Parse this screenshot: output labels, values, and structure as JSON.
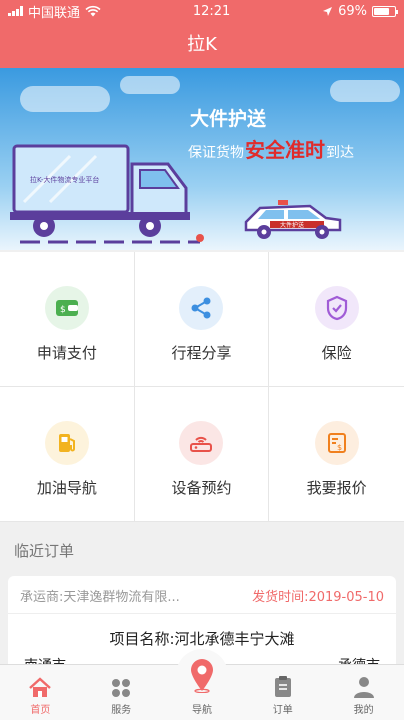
{
  "status_bar": {
    "carrier": "中国联通",
    "time": "12:21",
    "battery": "69%"
  },
  "nav": {
    "title": "拉K"
  },
  "banner": {
    "headline": "大件护送",
    "sub_prefix": "保证货物",
    "sub_highlight": "安全准时",
    "sub_suffix": "到达",
    "truck_text": "拉K-大件物流专业平台",
    "car_text": "大件护送"
  },
  "grid": [
    {
      "label": "申请支付",
      "icon": "wallet-icon",
      "color": "#4caf50"
    },
    {
      "label": "行程分享",
      "icon": "share-icon",
      "color": "#3d8fe0"
    },
    {
      "label": "保险",
      "icon": "shield-icon",
      "color": "#a05cd6"
    },
    {
      "label": "加油导航",
      "icon": "fuel-icon",
      "color": "#f2b320"
    },
    {
      "label": "设备预约",
      "icon": "router-icon",
      "color": "#e8524a"
    },
    {
      "label": "我要报价",
      "icon": "quote-icon",
      "color": "#f0801e"
    }
  ],
  "recent": {
    "title": "临近订单",
    "order": {
      "carrier": "承运商:天津逸群物流有限...",
      "ship_time": "发货时间:2019-05-10",
      "project": "项目名称:河北承德丰宁大滩",
      "from": "南通市",
      "to": "承德市"
    }
  },
  "tabbar": {
    "items": [
      {
        "label": "首页",
        "icon": "home-icon",
        "active": true
      },
      {
        "label": "服务",
        "icon": "services-icon",
        "active": false
      },
      {
        "label": "导航",
        "icon": "location-pin-icon",
        "active": false
      },
      {
        "label": "订单",
        "icon": "clipboard-icon",
        "active": false
      },
      {
        "label": "我的",
        "icon": "person-icon",
        "active": false
      }
    ]
  },
  "colors": {
    "brand": "#f06a6a"
  }
}
